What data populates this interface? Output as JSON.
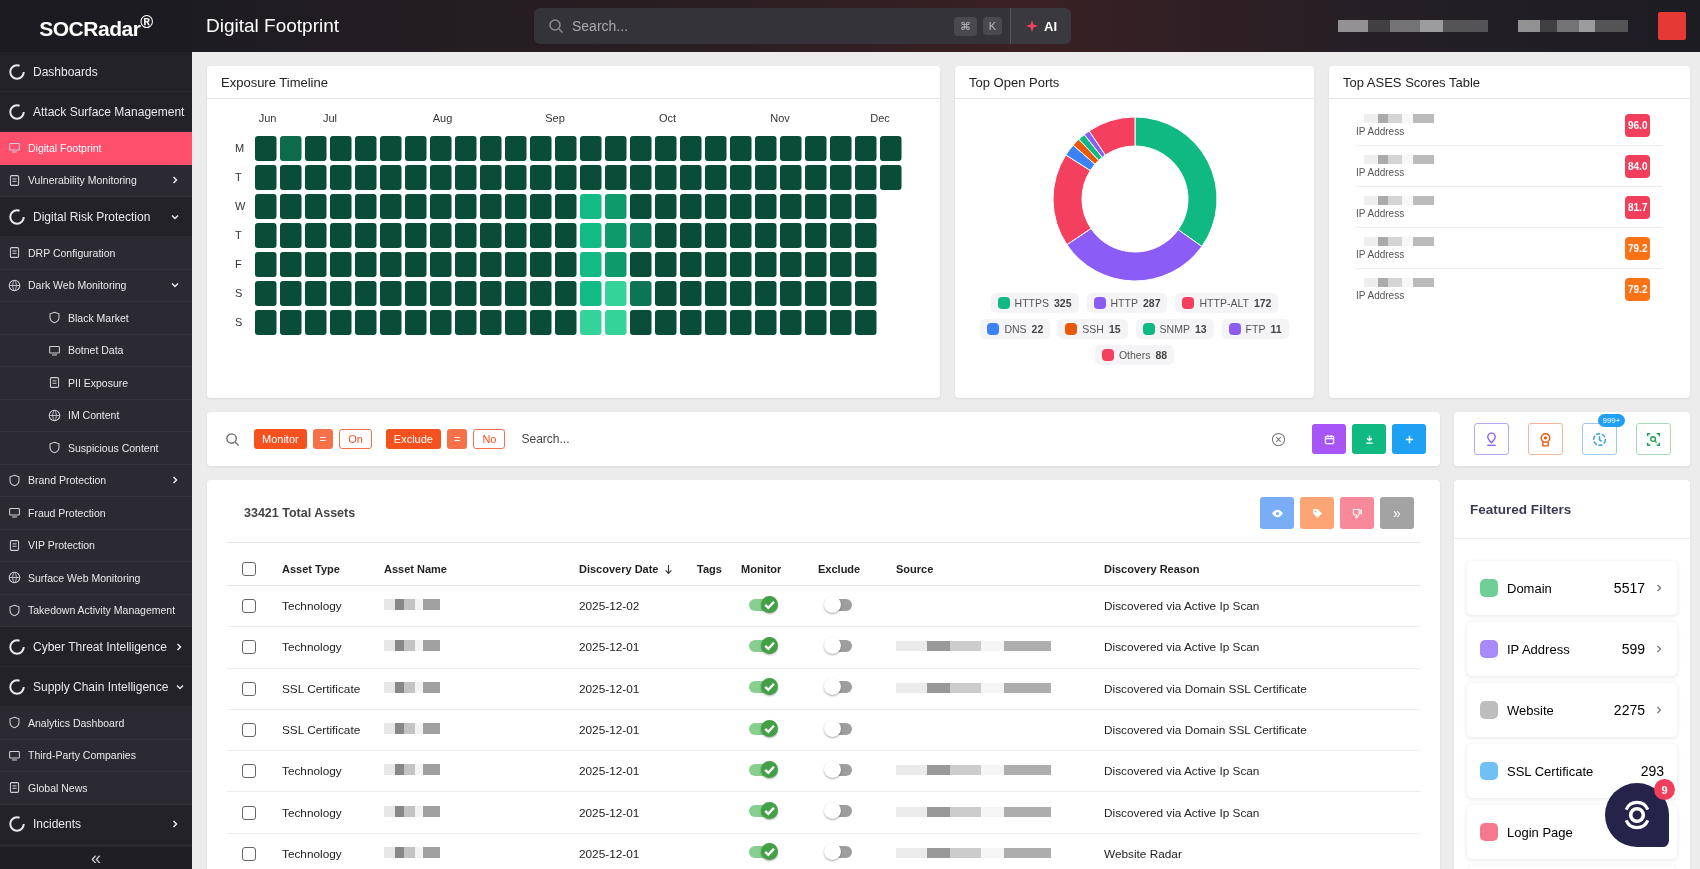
{
  "header": {
    "logo": "SOCRadar$^{®}$",
    "title": "Digital Footprint",
    "search_placeholder": "Search...",
    "keys": [
      "⌘",
      "K"
    ],
    "ai_button": "AI"
  },
  "sidebar": {
    "items": [
      {
        "kind": "section",
        "label": "Dashboards",
        "selected": false
      },
      {
        "kind": "section",
        "label": "Attack Surface Management",
        "selected": false,
        "expanded": true,
        "children": [
          {
            "kind": "item",
            "label": "Digital Footprint",
            "selected": true
          },
          {
            "kind": "item",
            "label": "Vulnerability Monitoring",
            "selected": false,
            "expanded": false
          }
        ]
      },
      {
        "kind": "section",
        "label": "Digital Risk Protection",
        "selected": false,
        "expanded": true,
        "children": [
          {
            "kind": "item",
            "label": "DRP Configuration",
            "selected": false
          },
          {
            "kind": "item",
            "label": "Dark Web Monitoring",
            "selected": false,
            "expanded": true,
            "children": [
              {
                "kind": "item",
                "label": "Black Market",
                "selected": false
              },
              {
                "kind": "item",
                "label": "Botnet Data",
                "selected": false
              },
              {
                "kind": "item",
                "label": "PII Exposure",
                "selected": false
              },
              {
                "kind": "item",
                "label": "IM Content",
                "selected": false
              },
              {
                "kind": "item",
                "label": "Suspicious Content",
                "selected": false
              }
            ]
          },
          {
            "kind": "item",
            "label": "Brand Protection",
            "selected": false,
            "expanded": false
          },
          {
            "kind": "item",
            "label": "Fraud Protection",
            "selected": false
          },
          {
            "kind": "item",
            "label": "VIP Protection",
            "selected": false
          },
          {
            "kind": "item",
            "label": "Surface Web Monitoring",
            "selected": false
          },
          {
            "kind": "item",
            "label": "Takedown Activity Management",
            "selected": false
          }
        ]
      },
      {
        "kind": "section",
        "label": "Cyber Threat Intelligence",
        "selected": false,
        "expanded": false
      },
      {
        "kind": "section",
        "label": "Supply Chain Intelligence",
        "selected": false,
        "expanded": true,
        "children": [
          {
            "kind": "item",
            "label": "Analytics Dashboard",
            "selected": false
          },
          {
            "kind": "item",
            "label": "Third-Party Companies",
            "selected": false
          },
          {
            "kind": "item",
            "label": "Global News",
            "selected": false
          }
        ]
      },
      {
        "kind": "section",
        "label": "Incidents",
        "selected": false,
        "expanded": false
      }
    ],
    "collapse": "«"
  },
  "exposure_timeline": {
    "title": "Exposure Timeline",
    "months": [
      "Jun",
      "Jul",
      "Aug",
      "Sep",
      "Oct",
      "Nov",
      "Dec"
    ],
    "days": [
      "M",
      "T",
      "W",
      "T",
      "F",
      "S",
      "S"
    ]
  },
  "top_open_ports": {
    "title": "Top Open Ports",
    "chart_data": {
      "type": "donut",
      "categories": [
        "HTTPS",
        "HTTP",
        "HTTP-ALT",
        "DNS",
        "SSH",
        "SNMP",
        "FTP",
        "Others"
      ],
      "values": [
        325,
        287,
        172,
        22,
        15,
        13,
        11,
        88
      ],
      "colors": [
        "#10b981",
        "#8b5cf6",
        "#f43f5e",
        "#3b82f6",
        "#ea580c",
        "#10b981",
        "#8b5cf6",
        "#f43f5e"
      ],
      "legend": "bottom",
      "data_labels": true
    }
  },
  "ases_scores": {
    "title": "Top ASES Scores Table",
    "rows": [
      {
        "type": "IP Address",
        "score": "96.0",
        "color": "#f03e5c"
      },
      {
        "type": "IP Address",
        "score": "84.0",
        "color": "#f03e5c"
      },
      {
        "type": "IP Address",
        "score": "81.7",
        "color": "#f03e5c"
      },
      {
        "type": "IP Address",
        "score": "79.2",
        "color": "#f97316"
      },
      {
        "type": "IP Address",
        "score": "79.2",
        "color": "#f97316"
      }
    ]
  },
  "filter_bar": {
    "chips": [
      {
        "field": "Monitor",
        "operator": "=",
        "value": "On"
      },
      {
        "field": "Exclude",
        "operator": "=",
        "value": "No"
      }
    ],
    "search_placeholder": "Search..."
  },
  "quick_icons": {
    "history_badge": "999+"
  },
  "assets": {
    "total": "33421 Total Assets",
    "more_button": "»",
    "select_all": false,
    "columns": [
      "Asset Type",
      "Asset Name",
      "Discovery Date",
      "Tags",
      "Monitor",
      "Exclude",
      "Source",
      "Discovery Reason"
    ],
    "rows": [
      {
        "selected": false,
        "asset_type": "Technology",
        "date": "2025-12-02",
        "monitor": true,
        "exclude": false,
        "source_hidden": false,
        "reason": "Discovered via Active Ip Scan"
      },
      {
        "selected": false,
        "asset_type": "Technology",
        "date": "2025-12-01",
        "monitor": true,
        "exclude": false,
        "source_hidden": true,
        "reason": "Discovered via Active Ip Scan"
      },
      {
        "selected": false,
        "asset_type": "SSL Certificate",
        "date": "2025-12-01",
        "monitor": true,
        "exclude": false,
        "source_hidden": true,
        "reason": "Discovered via Domain SSL Certificate"
      },
      {
        "selected": false,
        "asset_type": "SSL Certificate",
        "date": "2025-12-01",
        "monitor": true,
        "exclude": false,
        "source_hidden": false,
        "reason": "Discovered via Domain SSL Certificate"
      },
      {
        "selected": false,
        "asset_type": "Technology",
        "date": "2025-12-01",
        "monitor": true,
        "exclude": false,
        "source_hidden": true,
        "reason": "Discovered via Active Ip Scan"
      },
      {
        "selected": false,
        "asset_type": "Technology",
        "date": "2025-12-01",
        "monitor": true,
        "exclude": false,
        "source_hidden": true,
        "reason": "Discovered via Active Ip Scan"
      },
      {
        "selected": false,
        "asset_type": "Technology",
        "date": "2025-12-01",
        "monitor": true,
        "exclude": false,
        "source_hidden": true,
        "reason": "Website Radar"
      }
    ]
  },
  "featured_filters": {
    "title": "Featured Filters",
    "items": [
      {
        "label": "Domain",
        "count": "5517",
        "color": "#6fcf97",
        "chevron": true
      },
      {
        "label": "IP Address",
        "count": "599",
        "color": "#a78bfa",
        "chevron": true
      },
      {
        "label": "Website",
        "count": "2275",
        "color": "#bdbdbd",
        "chevron": true
      },
      {
        "label": "SSL Certificate",
        "count": "293",
        "color": "#6ec1f2",
        "chevron": false
      },
      {
        "label": "Login Page",
        "color": "#f7778c"
      }
    ]
  },
  "chat": {
    "badge": "9"
  }
}
